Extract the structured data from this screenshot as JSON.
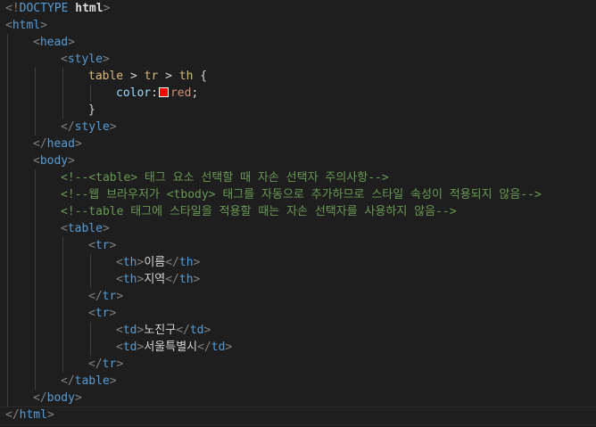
{
  "colors": {
    "background": "#1e1e1e",
    "tag": "#569cd6",
    "punctuation": "#808080",
    "comment": "#6a9955",
    "selector": "#d7ba7d",
    "property": "#9cdcfe",
    "value": "#ce9178",
    "text": "#d4d4d4",
    "swatch": "#ff0000"
  },
  "code": {
    "l1": {
      "open": "<!",
      "doctype": "DOCTYPE",
      "html": "html",
      "close": ">"
    },
    "l2": {
      "tag": "html"
    },
    "l3": {
      "tag": "head"
    },
    "l4": {
      "tag": "style"
    },
    "l5": {
      "selector": "table",
      "op1": ">",
      "sel2": "tr",
      "op2": ">",
      "sel3": "th",
      "brace": "{"
    },
    "l6": {
      "prop": "color",
      "colon": ":",
      "value": "red",
      "semi": ";"
    },
    "l7": {
      "brace": "}"
    },
    "l8": {
      "tag": "style"
    },
    "l9": {
      "tag": "head"
    },
    "l10": {
      "tag": "body"
    },
    "l11": {
      "comment": "<!--<table> 태그 요소 선택할 때 자손 선택자 주의사항-->"
    },
    "l12": {
      "comment": "<!--웹 브라우저가 <tbody> 태그를 자동으로 추가하므로 스타일 속성이 적용되지 않음-->"
    },
    "l13": {
      "comment": "<!--table 태그에 스타일을 적용할 때는 자손 선택자를 사용하지 않음-->"
    },
    "l14": {
      "tag": "table"
    },
    "l15": {
      "tag": "tr"
    },
    "l16": {
      "tag": "th",
      "text": "이름"
    },
    "l17": {
      "tag": "th",
      "text": "지역"
    },
    "l18": {
      "tag": "tr"
    },
    "l19": {
      "tag": "tr"
    },
    "l20": {
      "tag": "td",
      "text": "노진구"
    },
    "l21": {
      "tag": "td",
      "text": "서울특별시"
    },
    "l22": {
      "tag": "tr"
    },
    "l23": {
      "tag": "table"
    },
    "l24": {
      "tag": "body"
    },
    "l25": {
      "tag": "html"
    }
  }
}
